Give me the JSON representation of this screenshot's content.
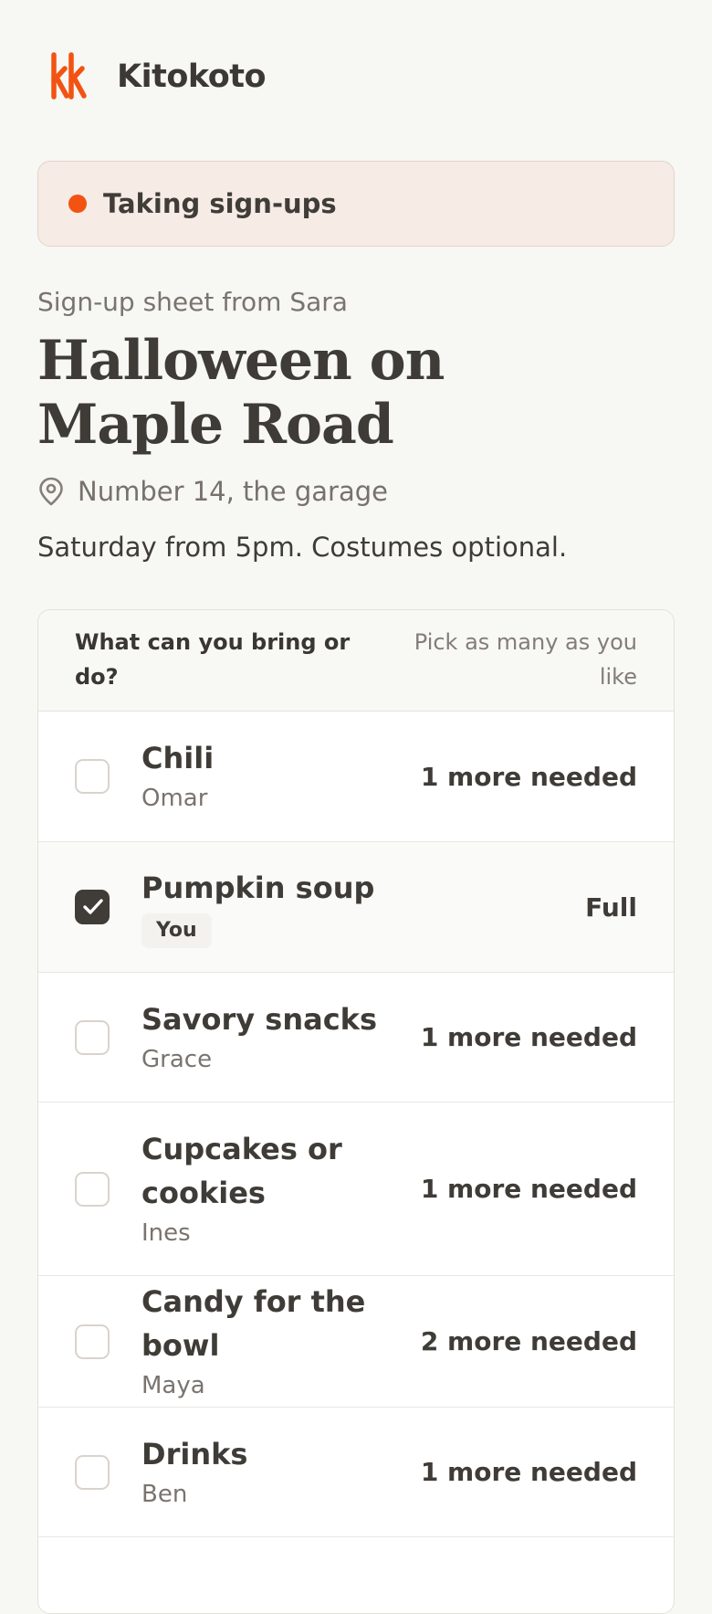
{
  "brand": {
    "name": "Kitokoto",
    "accent_color": "#f25312"
  },
  "status": {
    "label": "Taking sign-ups",
    "dot_color": "#f25312"
  },
  "event": {
    "subtitle": "Sign-up sheet from Sara",
    "title_line1": "Halloween on",
    "title_line2": "Maple Road",
    "location_icon": "map-pin-icon",
    "location": "Number 14, the garage",
    "description": "Saturday from 5pm. Costumes optional."
  },
  "signup": {
    "question": "What can you bring or do?",
    "hint": "Pick as many as you like",
    "items": [
      {
        "name": "Chili",
        "person": "Omar",
        "status": "1 more needed",
        "checked": false
      },
      {
        "name": "Pumpkin soup",
        "badge": "You",
        "status": "Full",
        "checked": true
      },
      {
        "name": "Savory snacks",
        "person": "Grace",
        "status": "1 more needed",
        "checked": false
      },
      {
        "name": "Cupcakes or cookies",
        "person": "Ines",
        "status": "1 more needed",
        "checked": false
      },
      {
        "name": "Candy for the bowl",
        "person": "Maya",
        "status": "2 more needed",
        "checked": false
      },
      {
        "name": "Drinks",
        "person": "Ben",
        "status": "1 more needed",
        "checked": false
      }
    ]
  }
}
